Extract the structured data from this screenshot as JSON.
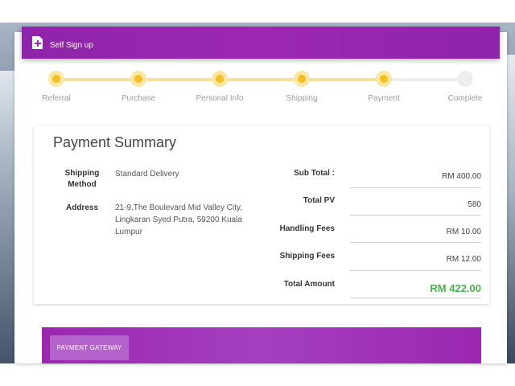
{
  "header": {
    "title": "Self Sign up",
    "icon": "add-document-icon"
  },
  "stepper": {
    "steps": [
      {
        "label": "Referral",
        "status": "done"
      },
      {
        "label": "Purchase",
        "status": "done"
      },
      {
        "label": "Personal Info",
        "status": "done"
      },
      {
        "label": "Shipping",
        "status": "done"
      },
      {
        "label": "Payment",
        "status": "done"
      },
      {
        "label": "Complete",
        "status": "pending"
      }
    ],
    "progress_fraction": 0.8
  },
  "summary": {
    "title": "Payment Summary",
    "shipping_method_label": "Shipping Method",
    "shipping_method_value": "Standard Delivery",
    "address_label": "Address",
    "address_lines": [
      "21-9,The Boulevard Mid Valley City,",
      "Lingkaran Syed Putra, 59200 Kuala",
      "Lumpur"
    ],
    "totals": [
      {
        "label": "Sub Total :",
        "value": "RM 400.00"
      },
      {
        "label": "Total PV",
        "value": "580"
      },
      {
        "label": "Handling Fees",
        "value": "RM 10.00"
      },
      {
        "label": "Shipping Fees",
        "value": "RM 12.00"
      },
      {
        "label": "Total Amount",
        "value": "RM 422.00"
      }
    ]
  },
  "gateway": {
    "button_label": "PAYMENT GATEWAY"
  },
  "colors": {
    "accent": "#9c27b0",
    "step_done": "#f5bf26",
    "total_green": "#4caf50"
  }
}
